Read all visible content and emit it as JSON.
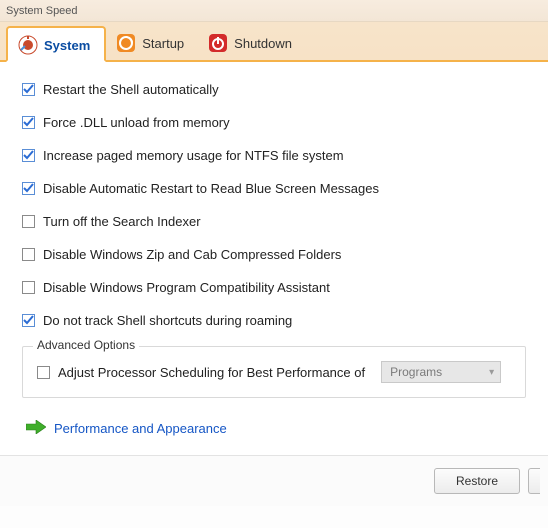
{
  "window": {
    "title": "System Speed"
  },
  "tabs": {
    "system": "System",
    "startup": "Startup",
    "shutdown": "Shutdown"
  },
  "options": {
    "restart_shell": {
      "label": "Restart the Shell automatically",
      "checked": true
    },
    "force_dll": {
      "label": "Force .DLL unload from memory",
      "checked": true
    },
    "paged_memory": {
      "label": "Increase paged memory usage for NTFS file system",
      "checked": true
    },
    "disable_restart": {
      "label": "Disable Automatic Restart to Read Blue Screen Messages",
      "checked": true
    },
    "search_indexer": {
      "label": "Turn off the Search Indexer",
      "checked": false
    },
    "zip_cab": {
      "label": "Disable Windows Zip and Cab Compressed Folders",
      "checked": false
    },
    "compat_assist": {
      "label": "Disable Windows Program Compatibility Assistant",
      "checked": false
    },
    "no_track_roam": {
      "label": "Do not track Shell shortcuts during roaming",
      "checked": true
    }
  },
  "advanced": {
    "legend": "Advanced Options",
    "adjust_scheduling": {
      "label": "Adjust Processor Scheduling for Best Performance of",
      "checked": false
    },
    "scheduling_select": {
      "value": "Programs"
    }
  },
  "link": {
    "label": "Performance and Appearance"
  },
  "footer": {
    "restore": "Restore"
  }
}
